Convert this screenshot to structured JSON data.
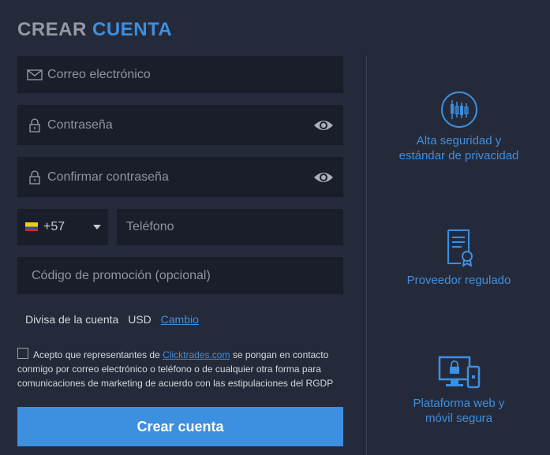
{
  "title": {
    "part1": "CREAR",
    "part2": "CUENTA"
  },
  "form": {
    "email_placeholder": "Correo electrónico",
    "password_placeholder": "Contraseña",
    "confirm_placeholder": "Confirmar contraseña",
    "phone_code": "+57",
    "phone_placeholder": "Teléfono",
    "promo_placeholder": "Código de promoción (opcional)",
    "currency_label": "Divisa de la cuenta",
    "currency_value": "USD",
    "currency_change": "Cambio",
    "consent_prefix": "Acepto que representantes de",
    "consent_link": "Clicktrades.com",
    "consent_suffix": "se pongan en contacto conmigo por correo electrónico o teléfono o de cualquier otra forma para comunicaciones de marketing de acuerdo con las estipulaciones del RGDP",
    "submit_label": "Crear cuenta"
  },
  "features": [
    {
      "icon": "candlestick-chart-icon",
      "line1": "Alta seguridad y",
      "line2": "estándar de privacidad"
    },
    {
      "icon": "certificate-icon",
      "line1": "Proveedor regulado",
      "line2": ""
    },
    {
      "icon": "devices-lock-icon",
      "line1": "Plataforma web y",
      "line2": "móvil segura"
    }
  ],
  "colors": {
    "accent": "#3d8fe0",
    "background": "#252a3a",
    "field": "#1a1e2a"
  }
}
